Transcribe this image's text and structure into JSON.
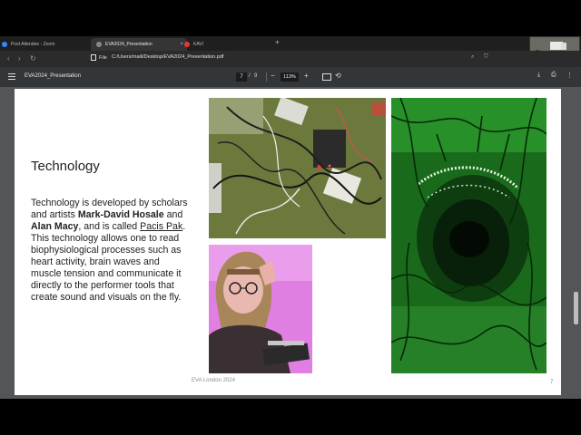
{
  "browser": {
    "tabs": [
      {
        "label": "Post Attendee - Zoom"
      },
      {
        "label": "EVA2024_Presentation"
      },
      {
        "label": "KAVI"
      }
    ],
    "file_label": "File",
    "url": "C:/Users/maili/Desktop/EVA2024_Presentation.pdf"
  },
  "pdf_toolbar": {
    "title": "EVA2024_Presentation",
    "current_page": "7",
    "page_sep": "/",
    "total_pages": "9",
    "zoom": "113%"
  },
  "slide": {
    "title": "Technology",
    "body_1": "Technology is developed by scholars and artists ",
    "name_1": "Mark-David Hosale",
    "body_2": " and ",
    "name_2": "Alan Macy",
    "body_3": ", and is called ",
    "link": "Pacis Pak",
    "body_4": ". This technology allows one to read biophysiological processes such as heart activity, brain waves and muscle tension and communicate it directly to the performer tools that create sound and visuals on the fly.",
    "footer": "EVA London 2024",
    "page_number": "7"
  },
  "colors": {
    "tab_bar": "#1f1f1f",
    "pdf_toolbar": "#333638",
    "viewer_bg": "#525659",
    "page_number": "#5b8db8"
  }
}
